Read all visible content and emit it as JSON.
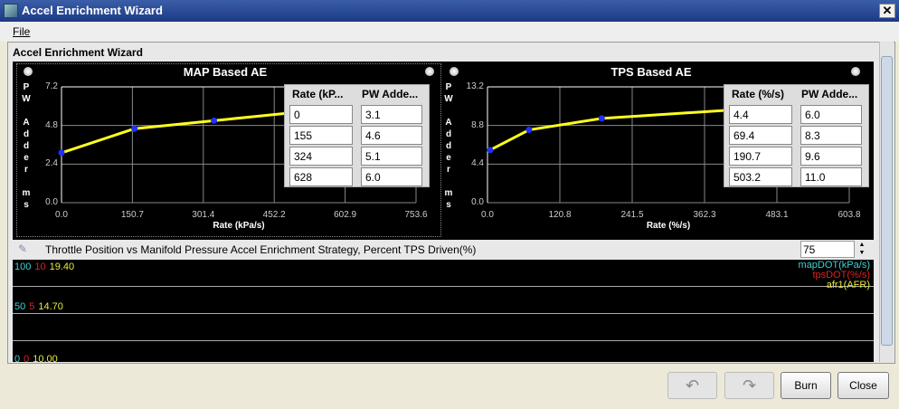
{
  "window": {
    "title": "Accel Enrichment Wizard",
    "close": "✕"
  },
  "menu": {
    "file": "File"
  },
  "panel_title": "Accel Enrichment Wizard",
  "chart_data": [
    {
      "type": "line",
      "title": "MAP Based AE",
      "xlabel": "Rate (kPa/s)",
      "ylabel": "PW Adder ms",
      "xticks": [
        "0.0",
        "150.7",
        "301.4",
        "452.2",
        "602.9",
        "753.6"
      ],
      "yticks": [
        "0.0",
        "2.4",
        "4.8",
        "7.2"
      ],
      "xlim": [
        0,
        753.6
      ],
      "ylim": [
        0,
        7.2
      ],
      "x": [
        0,
        155,
        324,
        628
      ],
      "y": [
        3.1,
        4.6,
        5.1,
        6.0
      ],
      "table": {
        "headers": [
          "Rate (kP...",
          "PW Adde..."
        ],
        "rows": [
          [
            "0",
            "3.1"
          ],
          [
            "155",
            "4.6"
          ],
          [
            "324",
            "5.1"
          ],
          [
            "628",
            "6.0"
          ]
        ]
      }
    },
    {
      "type": "line",
      "title": "TPS Based AE",
      "xlabel": "Rate (%/s)",
      "ylabel": "PW Adder ms",
      "xticks": [
        "0.0",
        "120.8",
        "241.5",
        "362.3",
        "483.1",
        "603.8"
      ],
      "yticks": [
        "0.0",
        "4.4",
        "8.8",
        "13.2"
      ],
      "xlim": [
        0,
        603.8
      ],
      "ylim": [
        0,
        13.2
      ],
      "x": [
        4.4,
        69.4,
        190.7,
        503.2
      ],
      "y": [
        6.0,
        8.3,
        9.6,
        11.0
      ],
      "table": {
        "headers": [
          "Rate (%/s)",
          "PW Adde..."
        ],
        "rows": [
          [
            "4.4",
            "6.0"
          ],
          [
            "69.4",
            "8.3"
          ],
          [
            "190.7",
            "9.6"
          ],
          [
            "503.2",
            "11.0"
          ]
        ]
      }
    }
  ],
  "strategy": {
    "label": "Throttle Position vs Manifold Pressure Accel Enrichment Strategy, Percent TPS Driven(%)",
    "value": "75"
  },
  "log": {
    "rows": [
      [
        "100",
        "10",
        "19.40"
      ],
      [
        "50",
        "5",
        "14.70"
      ],
      [
        "0",
        "0",
        "10.00"
      ]
    ],
    "legend": [
      "mapDOT(kPa/s)",
      "tpsDOT(%/s)",
      "afr1(AFR)"
    ],
    "colors": [
      "#40d0d0",
      "#e02020",
      "#e8e840"
    ]
  },
  "buttons": {
    "burn": "Burn",
    "close": "Close"
  }
}
